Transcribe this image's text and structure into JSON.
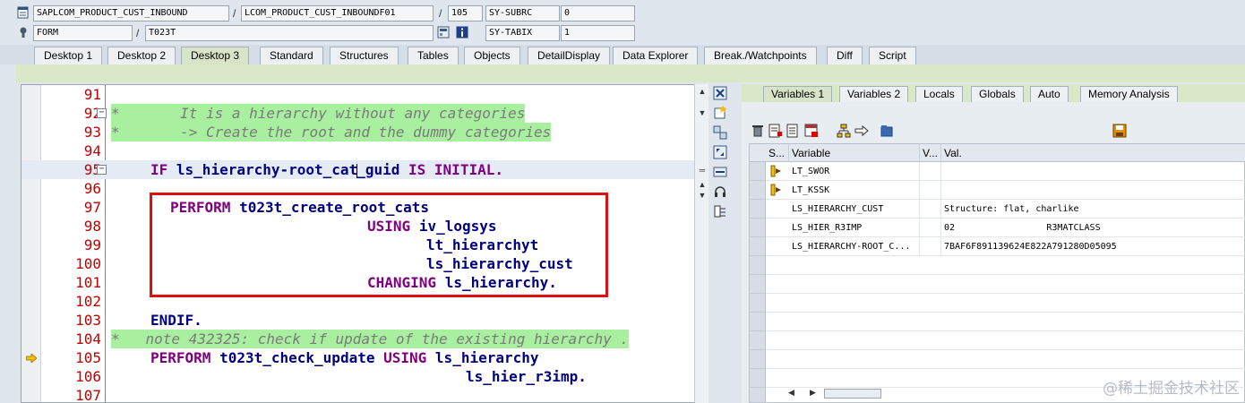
{
  "header": {
    "program": "SAPLCOM_PRODUCT_CUST_INBOUND",
    "include": "LCOM_PRODUCT_CUST_INBOUNDF01",
    "line": "105",
    "sysvar1_name": "SY-SUBRC",
    "sysvar1_value": "0",
    "event_type": "FORM",
    "event_name": "T023T",
    "sysvar2_name": "SY-TABIX",
    "sysvar2_value": "1",
    "separator": "/"
  },
  "desktop_tabs": [
    "Desktop 1",
    "Desktop 2",
    "Desktop 3",
    "Standard",
    "Structures",
    "Tables",
    "Objects",
    "DetailDisplay",
    "Data Explorer",
    "Break./Watchpoints",
    "Diff",
    "Script"
  ],
  "active_desktop_tab": "Desktop 3",
  "code": {
    "lines": [
      {
        "n": "91"
      },
      {
        "n": "92",
        "text": "*       It is a hierarchy without any categories"
      },
      {
        "n": "93",
        "text": "*       -> Create the root and the dummy categories"
      },
      {
        "n": "94"
      },
      {
        "n": "95",
        "kw1": "IF",
        "mid1": "ls_hierarchy-root_cat",
        "mid2": "guid",
        "kw2": "IS INITIAL."
      },
      {
        "n": "96"
      },
      {
        "n": "97",
        "kw1": "PERFORM",
        "rest": "t023t_create_root_cats"
      },
      {
        "n": "98",
        "kw1": "USING",
        "rest": "iv_logsys"
      },
      {
        "n": "99",
        "rest": "lt_hierarchyt"
      },
      {
        "n": "100",
        "rest": "ls_hierarchy_cust"
      },
      {
        "n": "101",
        "kw1": "CHANGING",
        "rest": "ls_hierarchy."
      },
      {
        "n": "102"
      },
      {
        "n": "103",
        "rest": "ENDIF."
      },
      {
        "n": "104",
        "text": "*   note 432325: check if update of the existing hierarchy ."
      },
      {
        "n": "105",
        "kw1": "PERFORM",
        "rest": "t023t_check_update",
        "kw2": "USING",
        "rest2": "ls_hierarchy"
      },
      {
        "n": "106",
        "rest": "ls_hier_r3imp."
      },
      {
        "n": "107"
      }
    ]
  },
  "var_tabs": [
    "Variables 1",
    "Variables 2",
    "Locals",
    "Globals",
    "Auto",
    "Memory Analysis"
  ],
  "active_var_tab": "Variables 1",
  "grid": {
    "headers": [
      "S...",
      "Variable",
      "V...",
      "Val."
    ],
    "rows": [
      {
        "variable": "LT_SWOR",
        "value": "",
        "icon": true
      },
      {
        "variable": "LT_KSSK",
        "value": "",
        "icon": true
      },
      {
        "variable": "LS_HIERARCHY_CUST",
        "value": "Structure: flat, charlike"
      },
      {
        "variable": "LS_HIER_R3IMP",
        "value": "02                 R3MATCLASS"
      },
      {
        "variable": "LS_HIERARCHY-ROOT_C...",
        "value": "7BAF6F891139624E822A791280D05095"
      }
    ]
  },
  "watermark": "@稀土掘金技术社区",
  "colors": {
    "comment_bg": "#a8f0a0",
    "keyword": "#800080",
    "identifier": "#000080",
    "linenum": "#c00000",
    "highlight_box": "#e01010"
  }
}
